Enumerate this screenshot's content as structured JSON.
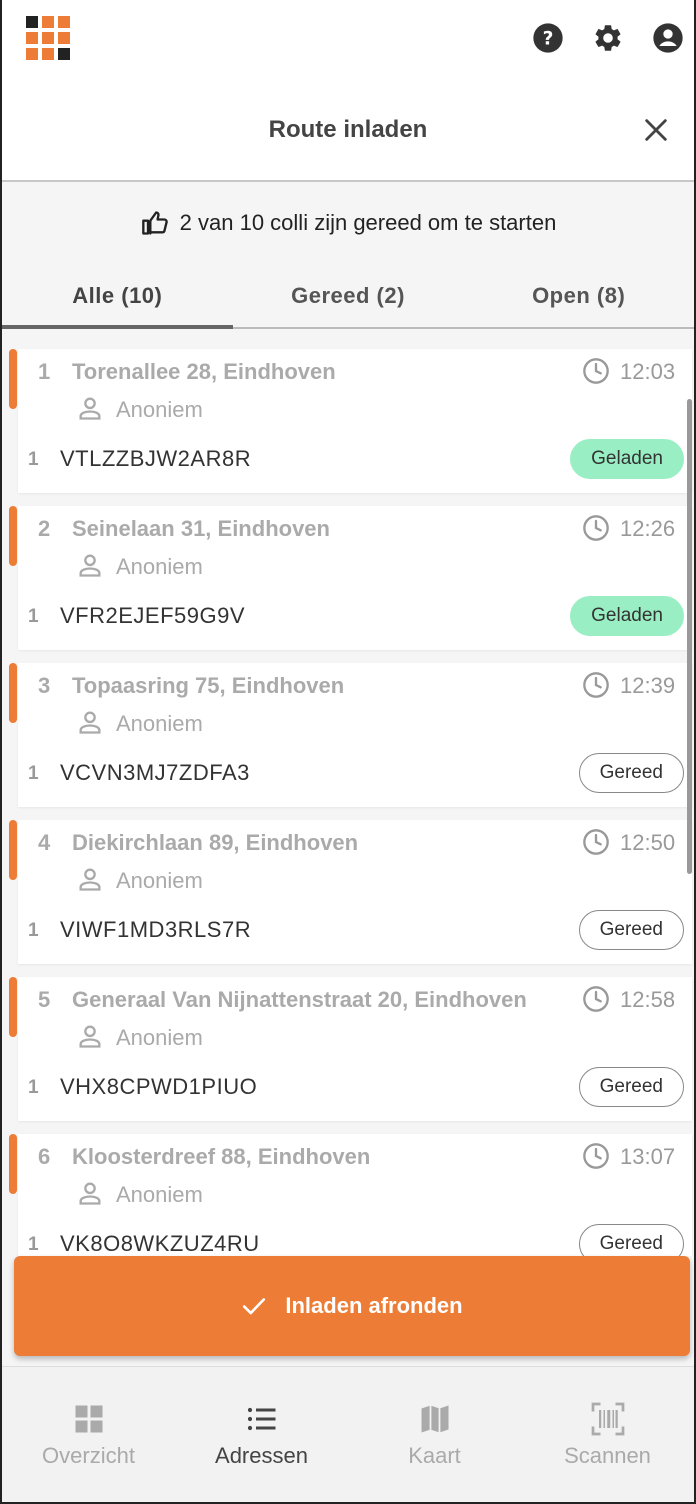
{
  "app": {
    "icons": {
      "logo": "grid-logo-icon",
      "help": "help-icon",
      "settings": "gear-icon",
      "account": "account-icon"
    }
  },
  "header": {
    "title": "Route inladen",
    "close_icon": "close-icon"
  },
  "info": {
    "text": "2 van 10 colli zijn gereed om te starten",
    "icon": "thumbs-up-icon"
  },
  "tabs": [
    {
      "label": "Alle (10)",
      "active": true
    },
    {
      "label": "Gereed (2)",
      "active": false
    },
    {
      "label": "Open (8)",
      "active": false
    }
  ],
  "stops": [
    {
      "number": "1",
      "address": "Torenallee 28, Eindhoven",
      "time": "12:03",
      "customer": "Anoniem",
      "colli_count": "1",
      "colli_code": "VTLZZBJW2AR8R",
      "status": "Geladen",
      "status_type": "loaded"
    },
    {
      "number": "2",
      "address": "Seinelaan 31, Eindhoven",
      "time": "12:26",
      "customer": "Anoniem",
      "colli_count": "1",
      "colli_code": "VFR2EJEF59G9V",
      "status": "Geladen",
      "status_type": "loaded"
    },
    {
      "number": "3",
      "address": "Topaasring 75, Eindhoven",
      "time": "12:39",
      "customer": "Anoniem",
      "colli_count": "1",
      "colli_code": "VCVN3MJ7ZDFA3",
      "status": "Gereed",
      "status_type": "ready"
    },
    {
      "number": "4",
      "address": "Diekirchlaan 89, Eindhoven",
      "time": "12:50",
      "customer": "Anoniem",
      "colli_count": "1",
      "colli_code": "VIWF1MD3RLS7R",
      "status": "Gereed",
      "status_type": "ready"
    },
    {
      "number": "5",
      "address": "Generaal Van Nijnattenstraat 20, Eindhoven",
      "time": "12:58",
      "customer": "Anoniem",
      "colli_count": "1",
      "colli_code": "VHX8CPWD1PIUO",
      "status": "Gereed",
      "status_type": "ready"
    },
    {
      "number": "6",
      "address": "Kloosterdreef 88, Eindhoven",
      "time": "13:07",
      "customer": "Anoniem",
      "colli_count": "1",
      "colli_code": "VK8O8WKZUZ4RU",
      "status": "Gereed",
      "status_type": "ready"
    }
  ],
  "action": {
    "label": "Inladen afronden",
    "icon": "check-icon"
  },
  "bottom_nav": [
    {
      "label": "Overzicht",
      "icon": "dashboard-icon",
      "active": false
    },
    {
      "label": "Adressen",
      "icon": "list-icon",
      "active": true
    },
    {
      "label": "Kaart",
      "icon": "map-icon",
      "active": false
    },
    {
      "label": "Scannen",
      "icon": "barcode-scan-icon",
      "active": false
    }
  ],
  "colors": {
    "accent": "#ed7d36",
    "loaded_badge": "#99efc3",
    "logo_dark": "#222222"
  }
}
